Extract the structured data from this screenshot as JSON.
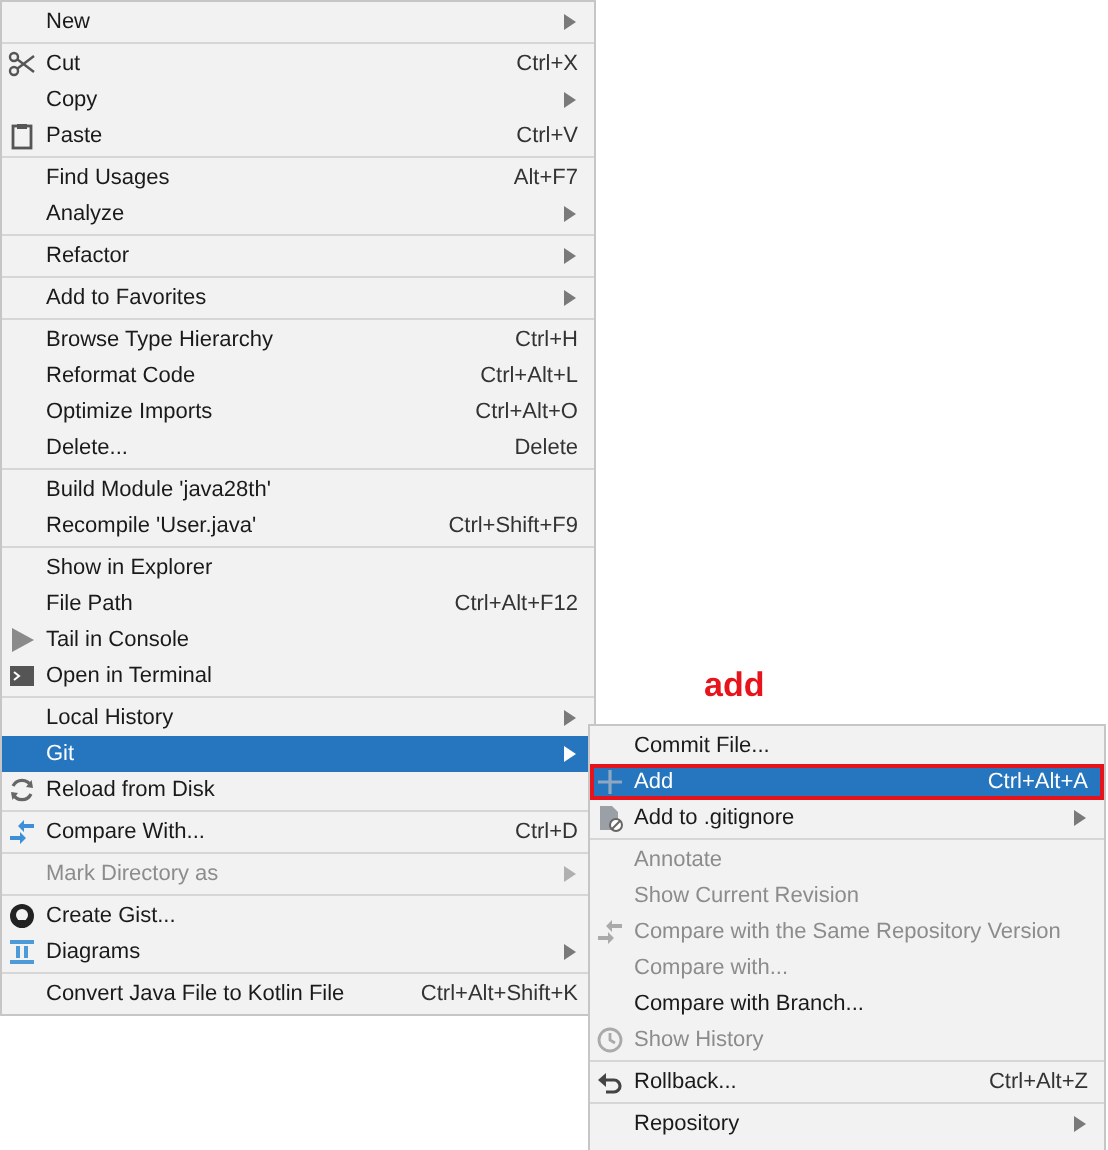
{
  "context_menu": {
    "groups": [
      [
        {
          "label": "New",
          "arrow": true,
          "disabled": false,
          "selected": false
        }
      ],
      [
        {
          "label": "Cut",
          "kind": "scissors",
          "shortcut": "Ctrl+X",
          "arrow": false,
          "disabled": false,
          "selected": false
        },
        {
          "label": "Copy",
          "arrow": true,
          "disabled": false,
          "selected": false
        },
        {
          "label": "Paste",
          "kind": "clipboard",
          "shortcut": "Ctrl+V",
          "arrow": false,
          "disabled": false,
          "selected": false
        }
      ],
      [
        {
          "label": "Find Usages",
          "shortcut": "Alt+F7",
          "arrow": false,
          "disabled": false,
          "selected": false
        },
        {
          "label": "Analyze",
          "arrow": true,
          "disabled": false,
          "selected": false
        }
      ],
      [
        {
          "label": "Refactor",
          "arrow": true,
          "disabled": false,
          "selected": false
        }
      ],
      [
        {
          "label": "Add to Favorites",
          "arrow": true,
          "disabled": false,
          "selected": false
        }
      ],
      [
        {
          "label": "Browse Type Hierarchy",
          "shortcut": "Ctrl+H",
          "arrow": false,
          "disabled": false,
          "selected": false
        },
        {
          "label": "Reformat Code",
          "shortcut": "Ctrl+Alt+L",
          "arrow": false,
          "disabled": false,
          "selected": false
        },
        {
          "label": "Optimize Imports",
          "shortcut": "Ctrl+Alt+O",
          "arrow": false,
          "disabled": false,
          "selected": false
        },
        {
          "label": "Delete...",
          "shortcut": "Delete",
          "arrow": false,
          "disabled": false,
          "selected": false
        }
      ],
      [
        {
          "label": "Build Module 'java28th'",
          "arrow": false,
          "disabled": false,
          "selected": false
        },
        {
          "label": "Recompile 'User.java'",
          "shortcut": "Ctrl+Shift+F9",
          "arrow": false,
          "disabled": false,
          "selected": false
        }
      ],
      [
        {
          "label": "Show in Explorer",
          "arrow": false,
          "disabled": false,
          "selected": false
        },
        {
          "label": "File Path",
          "shortcut": "Ctrl+Alt+F12",
          "arrow": false,
          "disabled": false,
          "selected": false
        },
        {
          "label": "Tail in Console",
          "kind": "play",
          "arrow": false,
          "disabled": false,
          "selected": false
        },
        {
          "label": "Open in Terminal",
          "kind": "terminal",
          "arrow": false,
          "disabled": false,
          "selected": false
        }
      ],
      [
        {
          "label": "Local History",
          "arrow": true,
          "disabled": false,
          "selected": false
        },
        {
          "label": "Git",
          "arrow": true,
          "disabled": false,
          "selected": true
        },
        {
          "label": "Reload from Disk",
          "kind": "reload",
          "arrow": false,
          "disabled": false,
          "selected": false
        }
      ],
      [
        {
          "label": "Compare With...",
          "kind": "compare",
          "shortcut": "Ctrl+D",
          "arrow": false,
          "disabled": false,
          "selected": false
        }
      ],
      [
        {
          "label": "Mark Directory as",
          "arrow": true,
          "disabled": true,
          "selected": false
        }
      ],
      [
        {
          "label": "Create Gist...",
          "kind": "octocat",
          "arrow": false,
          "disabled": false,
          "selected": false
        },
        {
          "label": "Diagrams",
          "kind": "diagram",
          "arrow": true,
          "disabled": false,
          "selected": false
        }
      ],
      [
        {
          "label": "Convert Java File to Kotlin File",
          "shortcut": "Ctrl+Alt+Shift+K",
          "arrow": false,
          "disabled": false,
          "selected": false
        }
      ]
    ]
  },
  "annotation": "add",
  "git_submenu": {
    "groups": [
      [
        {
          "label": "Commit File...",
          "arrow": false,
          "disabled": false,
          "selected": false,
          "outlined": false
        },
        {
          "label": "Add",
          "kind": "plus",
          "shortcut": "Ctrl+Alt+A",
          "arrow": false,
          "disabled": false,
          "selected": true,
          "outlined": true
        },
        {
          "label": "Add to .gitignore",
          "kind": "file",
          "arrow": true,
          "disabled": false,
          "selected": false,
          "outlined": false
        }
      ],
      [
        {
          "label": "Annotate",
          "arrow": false,
          "disabled": true,
          "selected": false,
          "outlined": false
        },
        {
          "label": "Show Current Revision",
          "arrow": false,
          "disabled": true,
          "selected": false,
          "outlined": false
        },
        {
          "label": "Compare with the Same Repository Version",
          "kind": "compare",
          "arrow": false,
          "disabled": true,
          "selected": false,
          "outlined": false
        },
        {
          "label": "Compare with...",
          "arrow": false,
          "disabled": true,
          "selected": false,
          "outlined": false
        },
        {
          "label": "Compare with Branch...",
          "arrow": false,
          "disabled": false,
          "selected": false,
          "outlined": false
        },
        {
          "label": "Show History",
          "kind": "clock",
          "arrow": false,
          "disabled": true,
          "selected": false,
          "outlined": false
        }
      ],
      [
        {
          "label": "Rollback...",
          "kind": "rollback",
          "shortcut": "Ctrl+Alt+Z",
          "arrow": false,
          "disabled": false,
          "selected": false,
          "outlined": false
        }
      ],
      [
        {
          "label": "Repository",
          "arrow": true,
          "disabled": false,
          "selected": false,
          "outlined": false
        }
      ]
    ]
  }
}
